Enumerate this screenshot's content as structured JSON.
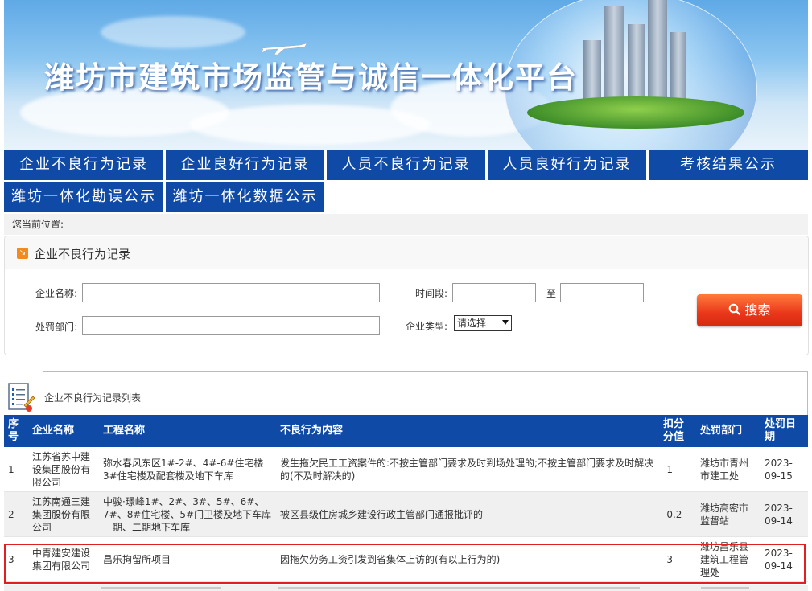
{
  "banner": {
    "title": "潍坊市建筑市场监管与诚信一体化平台"
  },
  "nav": {
    "row1": [
      "企业不良行为记录",
      "企业良好行为记录",
      "人员不良行为记录",
      "人员良好行为记录",
      "考核结果公示"
    ],
    "row2": [
      "潍坊一体化勘误公示",
      "潍坊一体化数据公示"
    ]
  },
  "location": {
    "label": "您当前位置:"
  },
  "search": {
    "section_title": "企业不良行为记录",
    "company_label": "企业名称:",
    "company_value": "",
    "period_label": "时间段:",
    "period_from": "",
    "period_to_label": "至",
    "period_to": "",
    "dept_label": "处罚部门:",
    "dept_value": "",
    "type_label": "企业类型:",
    "type_selected": "请选择",
    "search_button": "搜索"
  },
  "list": {
    "title": "企业不良行为记录列表",
    "headers": [
      "序号",
      "企业名称",
      "工程名称",
      "不良行为内容",
      "扣分分值",
      "处罚部门",
      "处罚日期"
    ],
    "rows": [
      {
        "no": "1",
        "company": "江苏省苏中建设集团股份有限公司",
        "project": "弥水春风东区1#-2#、4#-6#住宅楼3#住宅楼及配套楼及地下车库",
        "content": "发生拖欠民工工资案件的:不按主管部门要求及时到场处理的;不按主管部门要求及时解决的(不及时解决的)",
        "score": "-1",
        "dept": "潍坊市青州市建工处",
        "date": "2023-09-15"
      },
      {
        "no": "2",
        "company": "江苏南通三建集团股份有限公司",
        "project": "中骏·璟峰1#、2#、3#、5#、6#、7#、8#住宅楼、5#门卫楼及地下车库一期、二期地下车库",
        "content": "被区县级住房城乡建设行政主管部门通报批评的",
        "score": "-0.2",
        "dept": "潍坊高密市监督站",
        "date": "2023-09-14"
      },
      {
        "no": "3",
        "company": "中青建安建设集团有限公司",
        "project": "昌乐拘留所项目",
        "content": "因拖欠劳务工资引发到省集体上访的(有以上行为的)",
        "score": "-3",
        "dept": "潍坊昌乐县建筑工程管理处",
        "date": "2023-09-14"
      }
    ]
  }
}
